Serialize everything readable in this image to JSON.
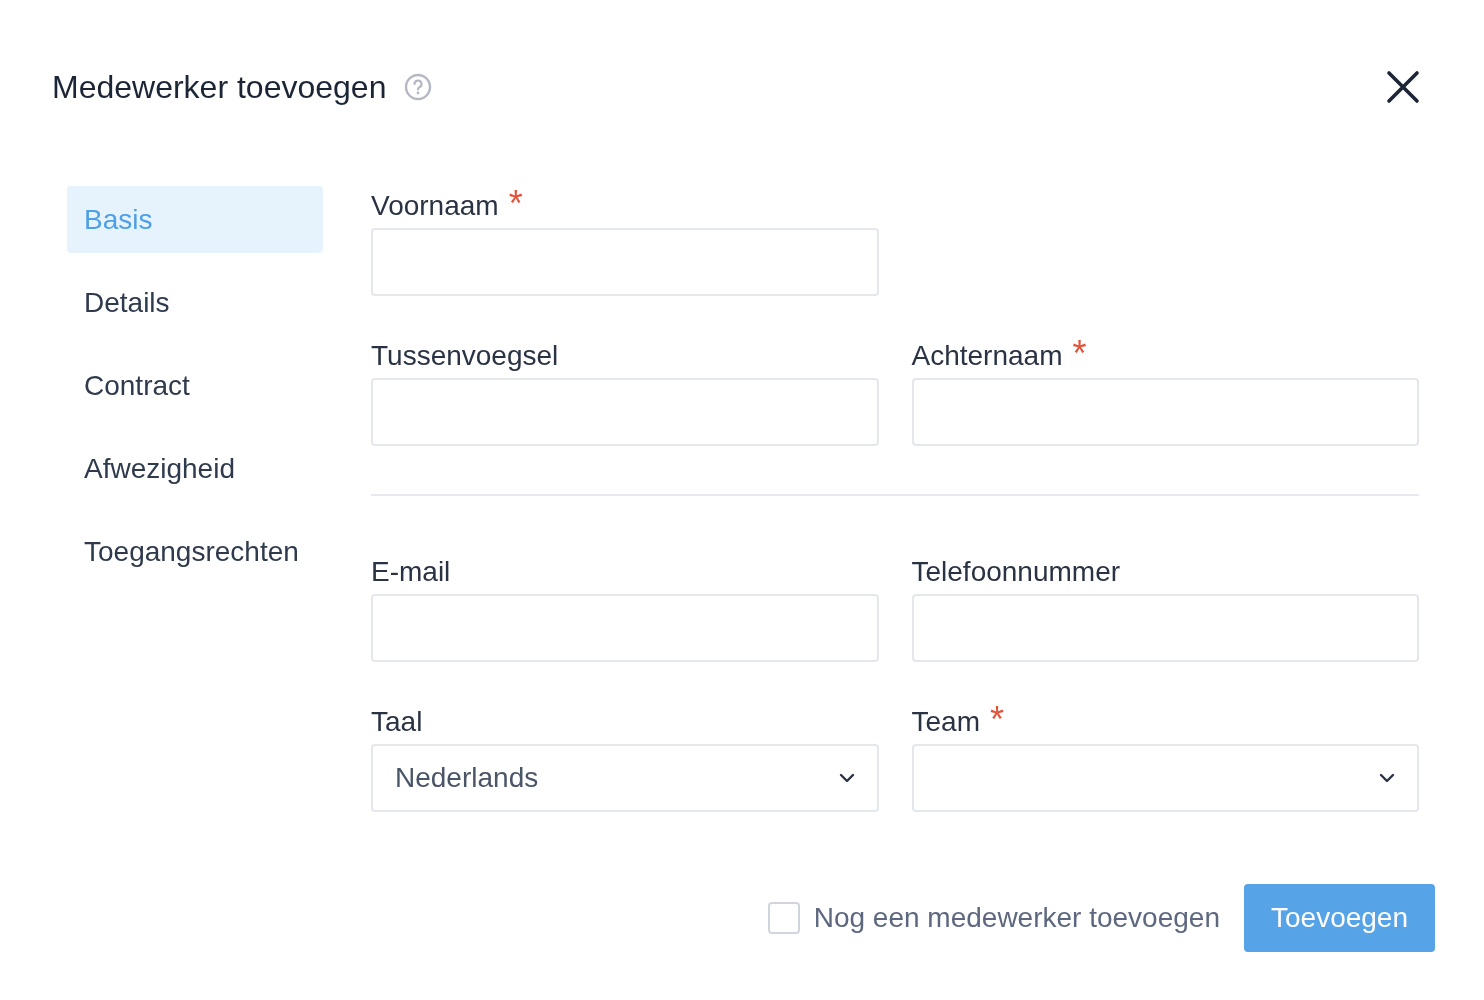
{
  "dialog": {
    "title": "Medewerker toevoegen"
  },
  "sidebar": {
    "items": [
      {
        "label": "Basis",
        "selected": true
      },
      {
        "label": "Details",
        "selected": false
      },
      {
        "label": "Contract",
        "selected": false
      },
      {
        "label": "Afwezigheid",
        "selected": false
      },
      {
        "label": "Toegangsrechten",
        "selected": false
      }
    ]
  },
  "form": {
    "sections": [
      {
        "fields": [
          {
            "kind": "text",
            "label": "Voornaam",
            "required_mark": "*"
          },
          {
            "kind": "spacer"
          },
          {
            "kind": "text",
            "label": "Tussenvoegsel"
          },
          {
            "kind": "text",
            "label": "Achternaam",
            "required_mark": "*"
          }
        ]
      },
      {
        "fields": [
          {
            "kind": "text",
            "label": "E-mail"
          },
          {
            "kind": "text",
            "label": "Telefoonnummer"
          },
          {
            "kind": "select",
            "label": "Taal",
            "value": "Nederlands"
          },
          {
            "kind": "select",
            "label": "Team",
            "required_mark": "*"
          }
        ]
      }
    ]
  },
  "footer": {
    "checkbox": {
      "label": "Nog een medewerker toevoegen",
      "checked": false
    },
    "submit": "Toevoegen"
  }
}
